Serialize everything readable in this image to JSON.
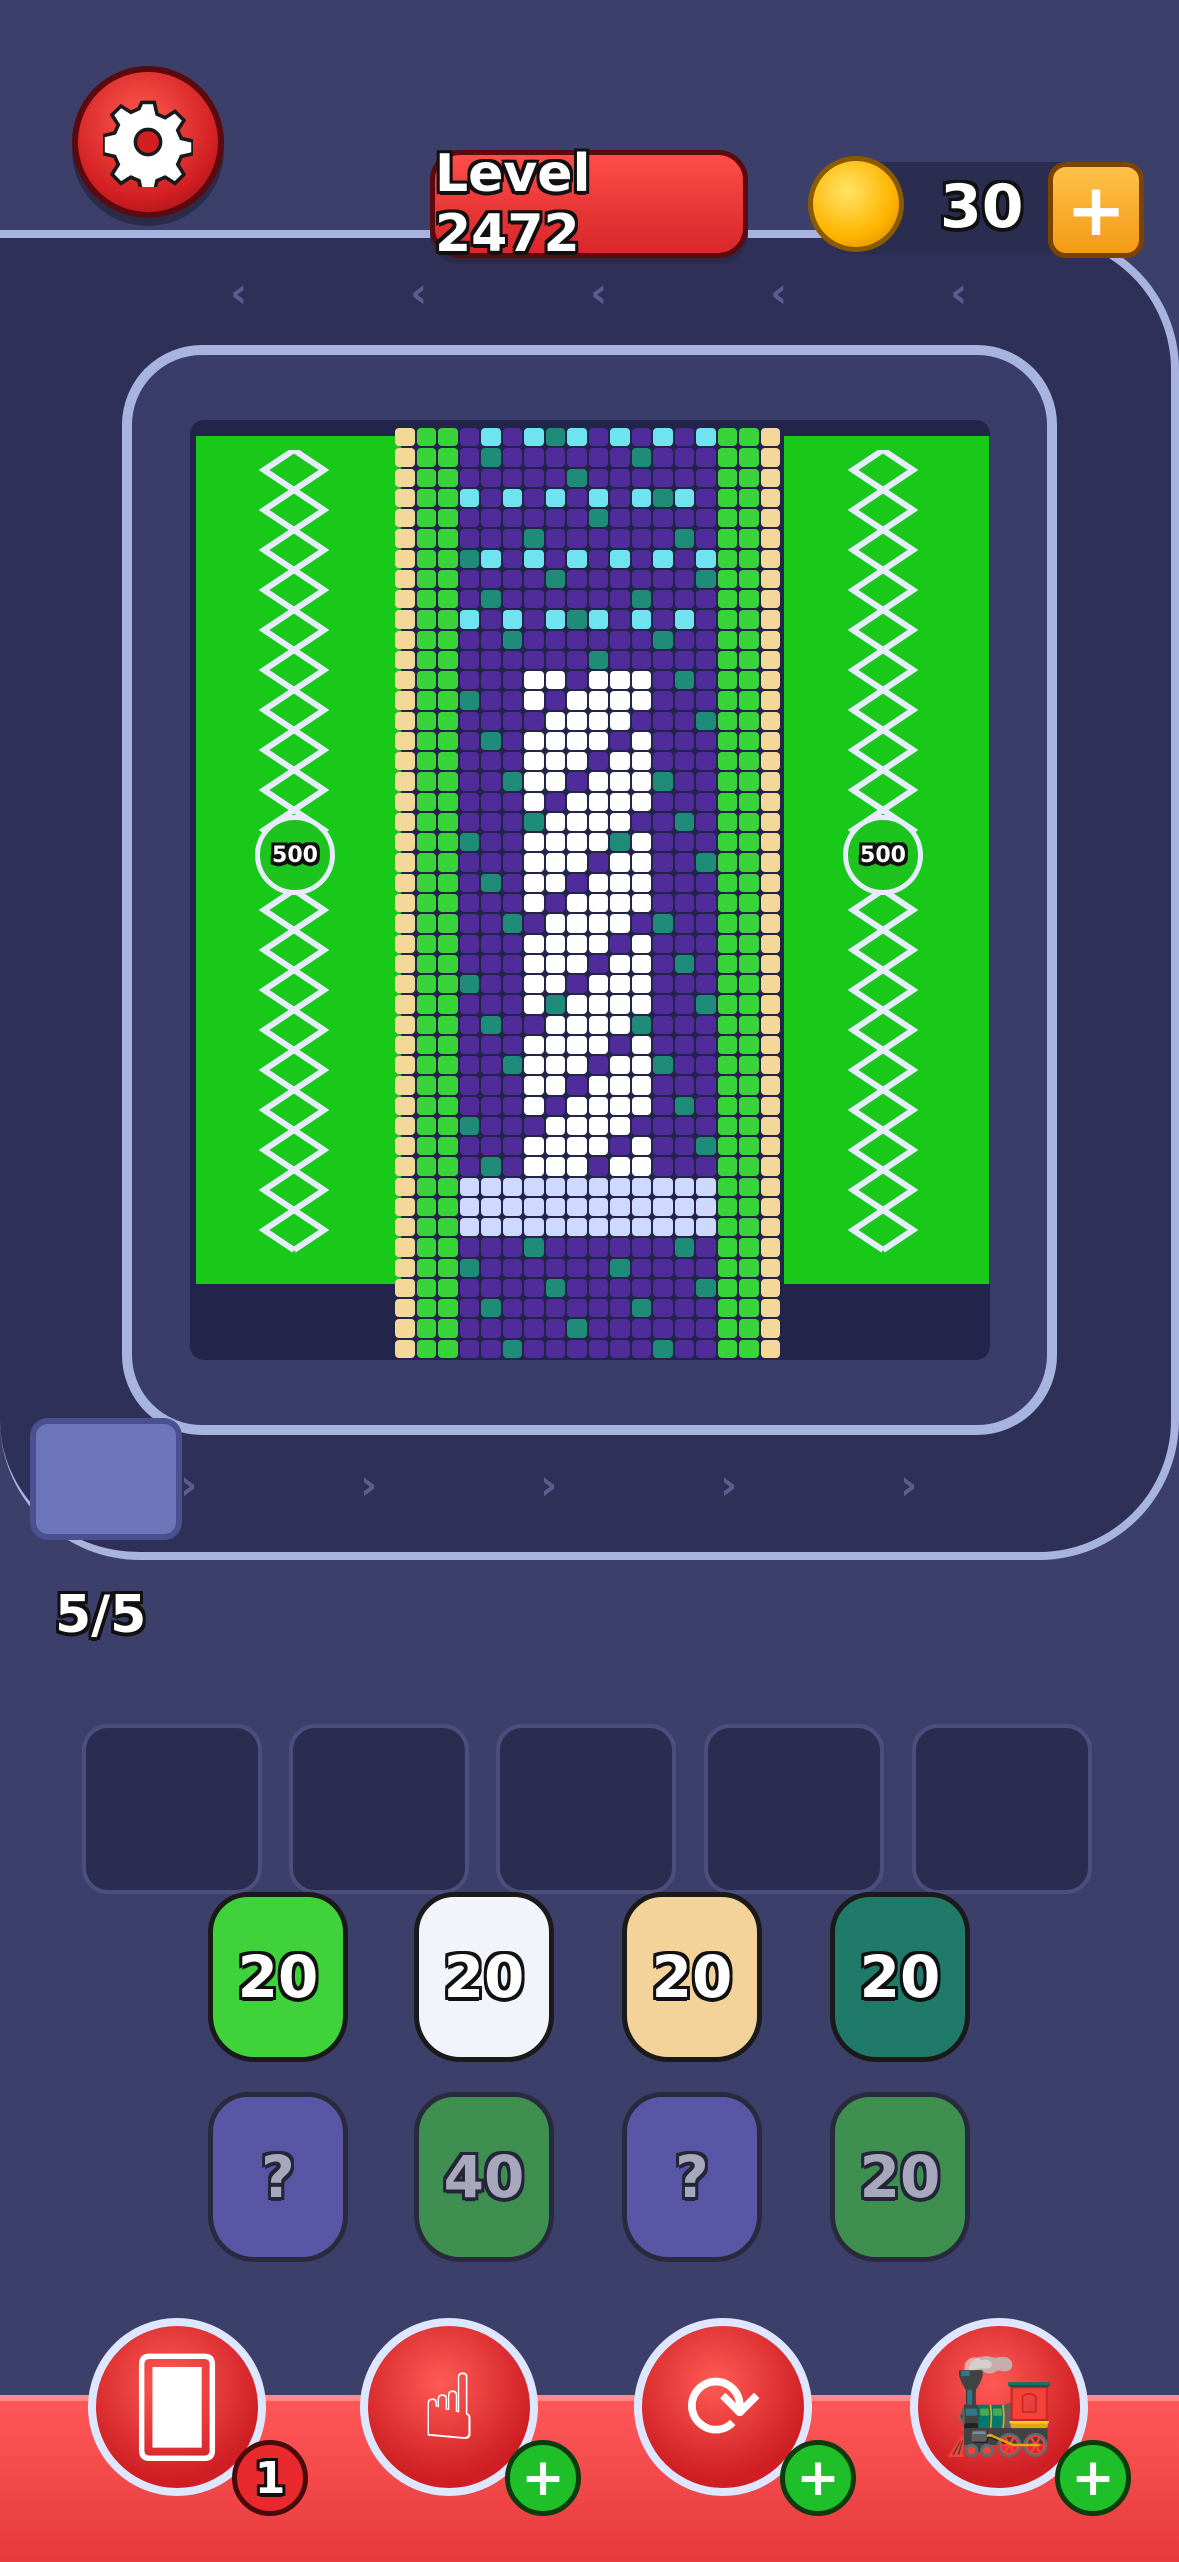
{
  "header": {
    "level_label": "Level 2472",
    "coins": "30",
    "add_coins_symbol": "+",
    "settings_icon": "gear-icon"
  },
  "board": {
    "left_spring_value": "500",
    "right_spring_value": "500"
  },
  "dispenser": {
    "count_label": "5/5"
  },
  "slots": {
    "count": 5
  },
  "bunnies": {
    "row1": [
      {
        "label": "20",
        "color": "#3fd23b"
      },
      {
        "label": "20",
        "color": "#f1f4fb"
      },
      {
        "label": "20",
        "color": "#f3d39a"
      },
      {
        "label": "20",
        "color": "#1f7a6a"
      }
    ],
    "row2": [
      {
        "label": "?",
        "color": "#6f6ad6"
      },
      {
        "label": "40",
        "color": "#3fd23b"
      },
      {
        "label": "?",
        "color": "#6f6ad6"
      },
      {
        "label": "20",
        "color": "#3fd23b"
      }
    ]
  },
  "boosters": [
    {
      "name": "add-slot-booster",
      "icon": "hand-card-plus-icon",
      "badge": "1"
    },
    {
      "name": "tap-booster",
      "icon": "pointing-hand-icon",
      "badge": "+"
    },
    {
      "name": "shuffle-booster",
      "icon": "refresh-icon",
      "badge": "+"
    },
    {
      "name": "train-booster",
      "icon": "train-icon",
      "badge": "+"
    }
  ]
}
